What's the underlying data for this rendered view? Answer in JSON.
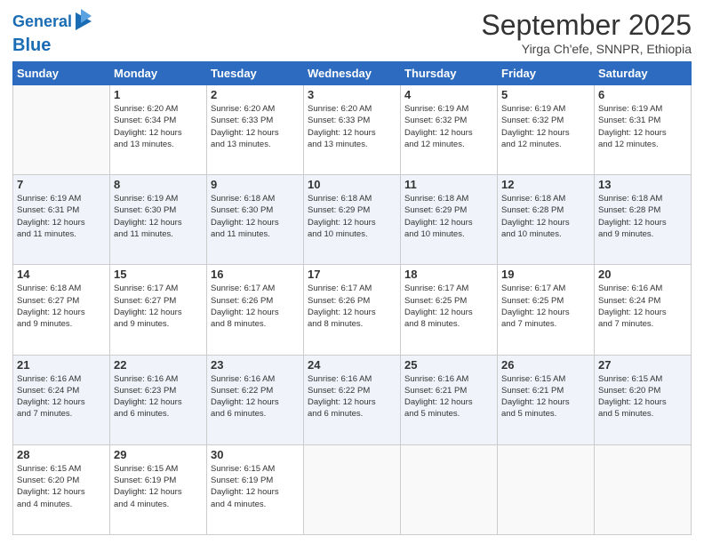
{
  "header": {
    "logo_line1": "General",
    "logo_line2": "Blue",
    "month": "September 2025",
    "location": "Yirga Ch'efe, SNNPR, Ethiopia"
  },
  "weekdays": [
    "Sunday",
    "Monday",
    "Tuesday",
    "Wednesday",
    "Thursday",
    "Friday",
    "Saturday"
  ],
  "weeks": [
    [
      {
        "day": "",
        "info": ""
      },
      {
        "day": "1",
        "info": "Sunrise: 6:20 AM\nSunset: 6:34 PM\nDaylight: 12 hours\nand 13 minutes."
      },
      {
        "day": "2",
        "info": "Sunrise: 6:20 AM\nSunset: 6:33 PM\nDaylight: 12 hours\nand 13 minutes."
      },
      {
        "day": "3",
        "info": "Sunrise: 6:20 AM\nSunset: 6:33 PM\nDaylight: 12 hours\nand 13 minutes."
      },
      {
        "day": "4",
        "info": "Sunrise: 6:19 AM\nSunset: 6:32 PM\nDaylight: 12 hours\nand 12 minutes."
      },
      {
        "day": "5",
        "info": "Sunrise: 6:19 AM\nSunset: 6:32 PM\nDaylight: 12 hours\nand 12 minutes."
      },
      {
        "day": "6",
        "info": "Sunrise: 6:19 AM\nSunset: 6:31 PM\nDaylight: 12 hours\nand 12 minutes."
      }
    ],
    [
      {
        "day": "7",
        "info": "Sunrise: 6:19 AM\nSunset: 6:31 PM\nDaylight: 12 hours\nand 11 minutes."
      },
      {
        "day": "8",
        "info": "Sunrise: 6:19 AM\nSunset: 6:30 PM\nDaylight: 12 hours\nand 11 minutes."
      },
      {
        "day": "9",
        "info": "Sunrise: 6:18 AM\nSunset: 6:30 PM\nDaylight: 12 hours\nand 11 minutes."
      },
      {
        "day": "10",
        "info": "Sunrise: 6:18 AM\nSunset: 6:29 PM\nDaylight: 12 hours\nand 10 minutes."
      },
      {
        "day": "11",
        "info": "Sunrise: 6:18 AM\nSunset: 6:29 PM\nDaylight: 12 hours\nand 10 minutes."
      },
      {
        "day": "12",
        "info": "Sunrise: 6:18 AM\nSunset: 6:28 PM\nDaylight: 12 hours\nand 10 minutes."
      },
      {
        "day": "13",
        "info": "Sunrise: 6:18 AM\nSunset: 6:28 PM\nDaylight: 12 hours\nand 9 minutes."
      }
    ],
    [
      {
        "day": "14",
        "info": "Sunrise: 6:18 AM\nSunset: 6:27 PM\nDaylight: 12 hours\nand 9 minutes."
      },
      {
        "day": "15",
        "info": "Sunrise: 6:17 AM\nSunset: 6:27 PM\nDaylight: 12 hours\nand 9 minutes."
      },
      {
        "day": "16",
        "info": "Sunrise: 6:17 AM\nSunset: 6:26 PM\nDaylight: 12 hours\nand 8 minutes."
      },
      {
        "day": "17",
        "info": "Sunrise: 6:17 AM\nSunset: 6:26 PM\nDaylight: 12 hours\nand 8 minutes."
      },
      {
        "day": "18",
        "info": "Sunrise: 6:17 AM\nSunset: 6:25 PM\nDaylight: 12 hours\nand 8 minutes."
      },
      {
        "day": "19",
        "info": "Sunrise: 6:17 AM\nSunset: 6:25 PM\nDaylight: 12 hours\nand 7 minutes."
      },
      {
        "day": "20",
        "info": "Sunrise: 6:16 AM\nSunset: 6:24 PM\nDaylight: 12 hours\nand 7 minutes."
      }
    ],
    [
      {
        "day": "21",
        "info": "Sunrise: 6:16 AM\nSunset: 6:24 PM\nDaylight: 12 hours\nand 7 minutes."
      },
      {
        "day": "22",
        "info": "Sunrise: 6:16 AM\nSunset: 6:23 PM\nDaylight: 12 hours\nand 6 minutes."
      },
      {
        "day": "23",
        "info": "Sunrise: 6:16 AM\nSunset: 6:22 PM\nDaylight: 12 hours\nand 6 minutes."
      },
      {
        "day": "24",
        "info": "Sunrise: 6:16 AM\nSunset: 6:22 PM\nDaylight: 12 hours\nand 6 minutes."
      },
      {
        "day": "25",
        "info": "Sunrise: 6:16 AM\nSunset: 6:21 PM\nDaylight: 12 hours\nand 5 minutes."
      },
      {
        "day": "26",
        "info": "Sunrise: 6:15 AM\nSunset: 6:21 PM\nDaylight: 12 hours\nand 5 minutes."
      },
      {
        "day": "27",
        "info": "Sunrise: 6:15 AM\nSunset: 6:20 PM\nDaylight: 12 hours\nand 5 minutes."
      }
    ],
    [
      {
        "day": "28",
        "info": "Sunrise: 6:15 AM\nSunset: 6:20 PM\nDaylight: 12 hours\nand 4 minutes."
      },
      {
        "day": "29",
        "info": "Sunrise: 6:15 AM\nSunset: 6:19 PM\nDaylight: 12 hours\nand 4 minutes."
      },
      {
        "day": "30",
        "info": "Sunrise: 6:15 AM\nSunset: 6:19 PM\nDaylight: 12 hours\nand 4 minutes."
      },
      {
        "day": "",
        "info": ""
      },
      {
        "day": "",
        "info": ""
      },
      {
        "day": "",
        "info": ""
      },
      {
        "day": "",
        "info": ""
      }
    ]
  ]
}
